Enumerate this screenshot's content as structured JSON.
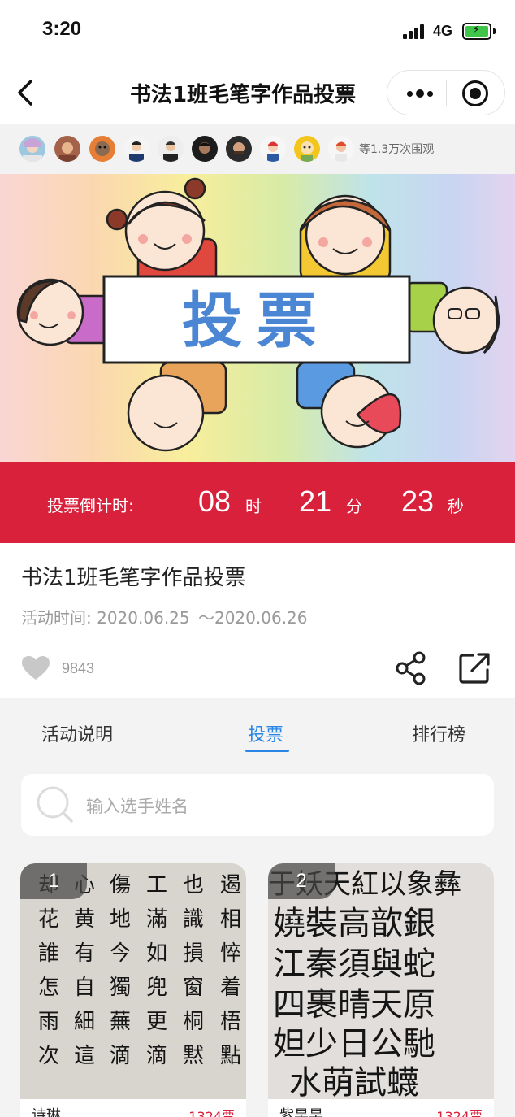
{
  "status_bar": {
    "time": "3:20",
    "network": "4G"
  },
  "nav": {
    "title": "书法1班毛笔字作品投票",
    "icons": [
      "back-arrow-icon",
      "more-dots-icon",
      "target-icon"
    ]
  },
  "viewers": {
    "count_text": "等1.3万次围观",
    "avatar_count": 10
  },
  "banner": {
    "title": "投票"
  },
  "countdown": {
    "label": "投票倒计时:",
    "hours": "08",
    "hours_unit": "时",
    "minutes": "21",
    "minutes_unit": "分",
    "seconds": "23",
    "seconds_unit": "秒"
  },
  "activity": {
    "title": "书法1班毛笔字作品投票",
    "time_label": "活动时间:",
    "time_start": "2020.06.25",
    "time_sep": "～",
    "time_end": "2020.06.26",
    "likes": "9843"
  },
  "tabs": [
    {
      "label": "活动说明"
    },
    {
      "label": "投票"
    },
    {
      "label": "排行榜"
    }
  ],
  "search": {
    "placeholder": "输入选手姓名"
  },
  "entries": [
    {
      "rank": "1",
      "name": "诗琳",
      "votes": "1324票",
      "text_columns": [
        "遏相悴着梧點",
        "也識損窗桐黙",
        "工滿如兜更滴",
        "傷地今獨蕪滴",
        "心黄有自細這",
        "却花誰怎雨次"
      ]
    },
    {
      "rank": "2",
      "name": "紫昊昊",
      "votes": "1324票",
      "text_rows": [
        "于妖天紅以象彝",
        "嬈裝高歆銀",
        "江秦須與蛇",
        "四裹晴天原",
        "妲少日公馳",
        "水萌試蠛"
      ]
    }
  ],
  "colors": {
    "accent_red": "#d9213c",
    "tab_active_blue": "#2a86e6",
    "banner_text_blue": "#4a86d4"
  }
}
